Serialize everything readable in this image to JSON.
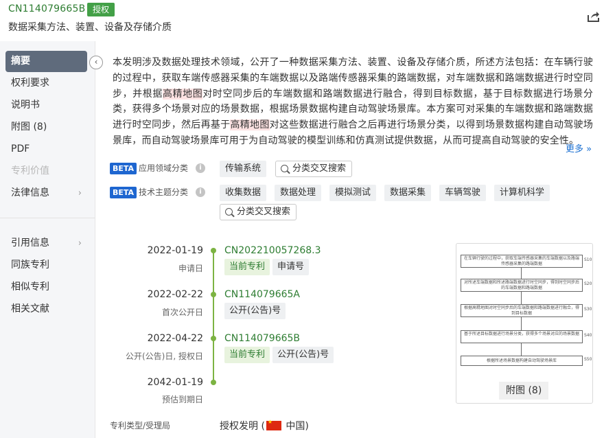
{
  "header": {
    "patent_number": "CN114079665B",
    "status_badge": "授权",
    "title": "数据采集方法、装置、设备及存储介质"
  },
  "sidebar": {
    "items": [
      {
        "label": "摘要"
      },
      {
        "label": "权利要求"
      },
      {
        "label": "说明书"
      },
      {
        "label": "附图 (8)"
      },
      {
        "label": "PDF"
      },
      {
        "label": "专利价值"
      },
      {
        "label": "法律信息"
      },
      {
        "label": "引用信息"
      },
      {
        "label": "同族专利"
      },
      {
        "label": "相似专利"
      },
      {
        "label": "相关文献"
      }
    ]
  },
  "abstract": {
    "part1": "本发明涉及数据处理技术领域，公开了一种数据采集方法、装置、设备及存储介质，所述方法包括：在车辆行驶的过程中，获取车端传感器采集的车端数据以及路端传感器采集的路端数据，对车端数据和路端数据进行时空同步，并根据",
    "highlight1": "高精地图",
    "part2": "对时空同步后的车端数据和路端数据进行融合，得到目标数据，基于目标数据进行场景分类，获得多个场景对应的场景数据，根据场景数据构建自动驾驶场景库。本方案可对采集的车端数据和路端数据进行时空同步，然后再基于",
    "highlight2": "高精地图",
    "part3": "对这些数据进行融合之后再进行场景分类，以得到场景数据构建自动驾驶场景库，而自动驾驶场景库可用于为自动驾驶的模型训练和仿真测试提供数据，从而可提高自动驾驶的安全性。",
    "more": "更多"
  },
  "classification": {
    "beta_label": "BETA",
    "domain": {
      "label": "应用领域分类",
      "tags": [
        "传输系统"
      ],
      "search": "分类交叉搜索"
    },
    "topic": {
      "label": "技术主题分类",
      "tags": [
        "收集数据",
        "数据处理",
        "模拟测试",
        "数据采集",
        "车辆驾驶",
        "计算机科学"
      ],
      "search": "分类交叉搜索"
    }
  },
  "timeline": [
    {
      "date": "2022-01-19",
      "sub": "申请日",
      "number": "CN202210057268.3",
      "tags": [
        "当前专利",
        "申请号"
      ]
    },
    {
      "date": "2022-02-22",
      "sub": "首次公开日",
      "number": "CN114079665A",
      "tags": [
        "公开(公告)号"
      ]
    },
    {
      "date": "2022-04-22",
      "sub": "公开(公告)日, 授权日",
      "number": "CN114079665B",
      "tags": [
        "当前专利",
        "公开(公告)号"
      ]
    },
    {
      "date": "2042-01-19",
      "sub": "预估到期日",
      "number": "",
      "tags": []
    }
  ],
  "figure": {
    "caption": "附图 (8)",
    "steps": [
      {
        "text": "在车辆行驶的过程中，获取车端传感器采集的车端数据以及路端传感器采集的路端数据",
        "code": "S10"
      },
      {
        "text": "对所述车端数据和所述路端数据进行时空同步，得到时空同步后的车端数据和路端数据",
        "code": "S20"
      },
      {
        "text": "根据高精地图对时空同步后的车端数据和路端数据进行融合，得到目标数据",
        "code": "S30"
      },
      {
        "text": "基于所述目标数据进行场景分类，获得多个场景对应的场景数据",
        "code": "S40"
      },
      {
        "text": "根据所述场景数据构建自动驾驶场景库",
        "code": "S50"
      }
    ]
  },
  "type_row": {
    "label": "专利类型/受理局",
    "value_prefix": "授权发明 (",
    "value_country": "中国",
    "value_suffix": ")"
  },
  "colors": {
    "accent_green": "#43a047",
    "link_blue": "#1a6fd1",
    "highlight": "#fde2e2",
    "sidebar_active": "#5f6b7c"
  }
}
